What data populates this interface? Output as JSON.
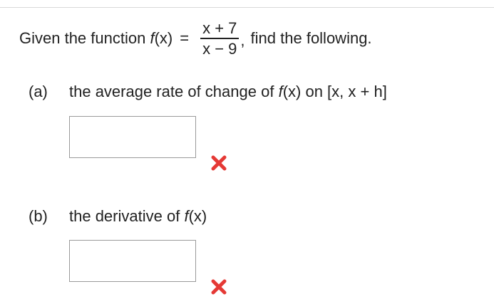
{
  "question": {
    "prefix": "Given the function",
    "function_name": "f",
    "function_arg": "(x)",
    "equals": "=",
    "numerator": "x + 7",
    "denominator": "x − 9",
    "suffix": "find the following."
  },
  "parts": [
    {
      "label": "(a)",
      "text_before": "the average rate of change of",
      "function_name": "f",
      "function_arg": "(x)",
      "text_after": "on [x, x + h]",
      "answer_value": "",
      "status": "incorrect"
    },
    {
      "label": "(b)",
      "text_before": "the derivative of",
      "function_name": "f",
      "function_arg": "(x)",
      "text_after": "",
      "answer_value": "",
      "status": "incorrect"
    }
  ],
  "colors": {
    "incorrect_mark": "#e53935",
    "text": "#222222",
    "box_border": "#9a9a9a"
  },
  "icons": {
    "incorrect": "x-mark-icon"
  }
}
